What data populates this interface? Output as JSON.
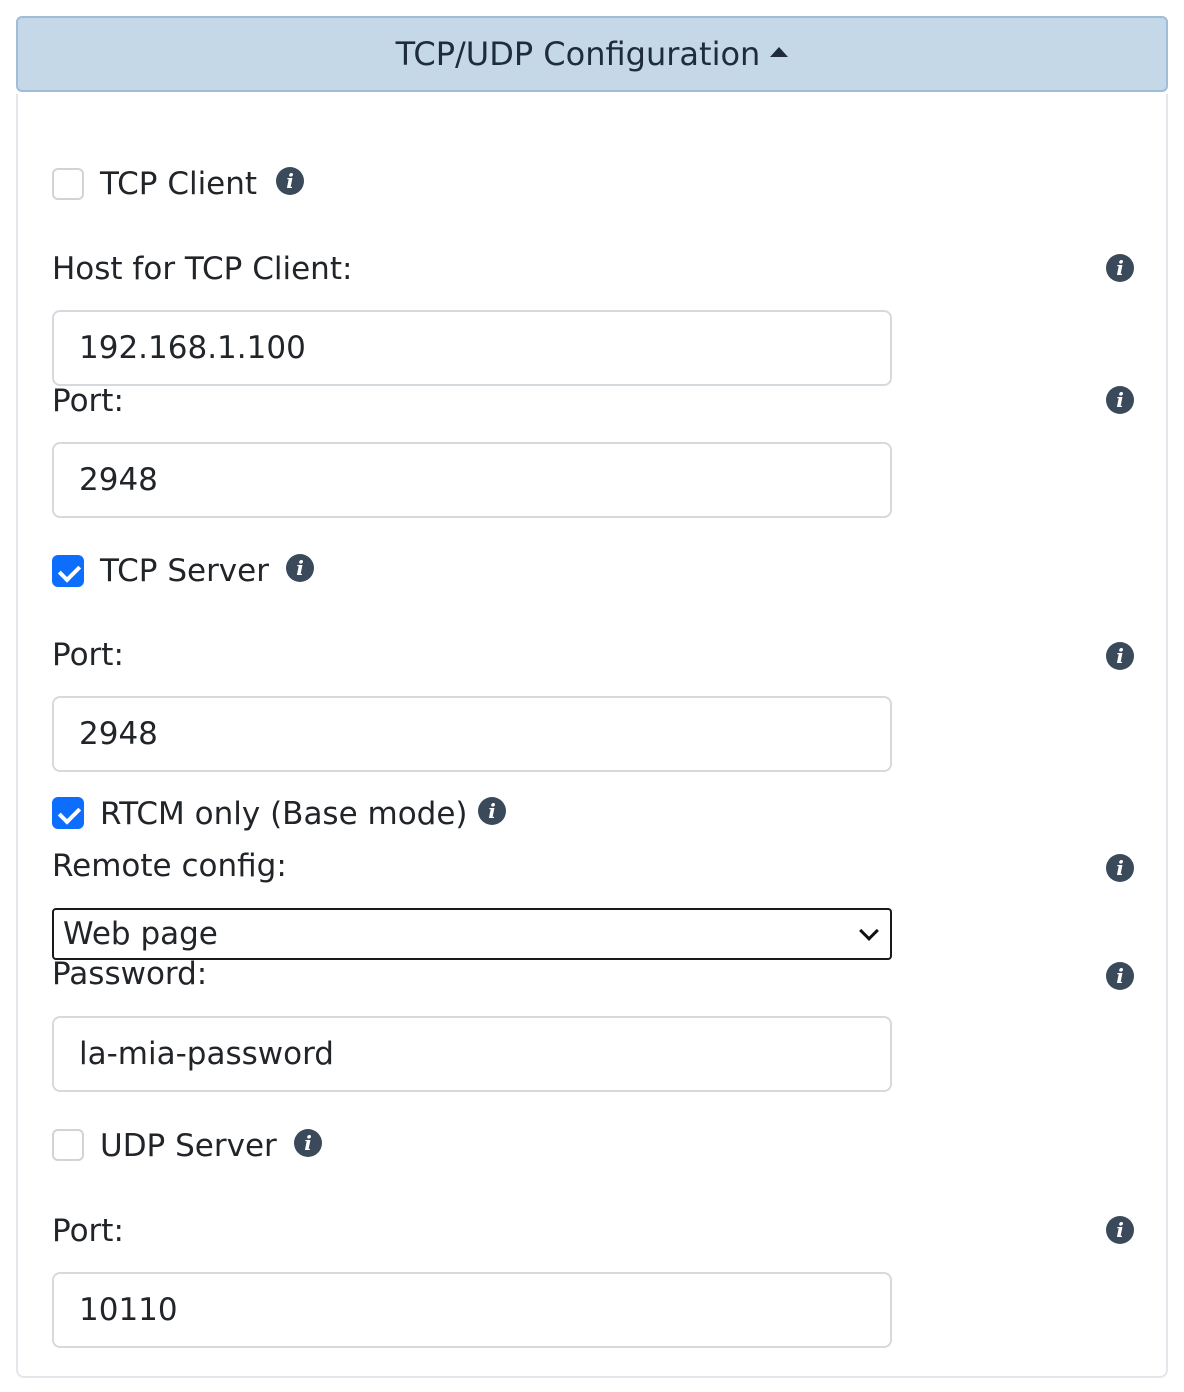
{
  "header": {
    "title": "TCP/UDP Configuration"
  },
  "tcp_client": {
    "label": "TCP Client",
    "checked": false,
    "host_label": "Host for TCP Client:",
    "host_value": "192.168.1.100",
    "port_label": "Port:",
    "port_value": "2948"
  },
  "tcp_server": {
    "label": "TCP Server",
    "checked": true,
    "port_label": "Port:",
    "port_value": "2948",
    "rtcm_label": "RTCM only (Base mode)",
    "rtcm_checked": true,
    "remote_config_label": "Remote config:",
    "remote_config_value": "Web page",
    "password_label": "Password:",
    "password_value": "la-mia-password"
  },
  "udp_server": {
    "label": "UDP Server",
    "checked": false,
    "port_label": "Port:",
    "port_value": "10110"
  },
  "colors": {
    "header_bg": "#c4d8e8",
    "checkbox_checked": "#0d6efd",
    "info_icon": "#3a4a5a"
  }
}
